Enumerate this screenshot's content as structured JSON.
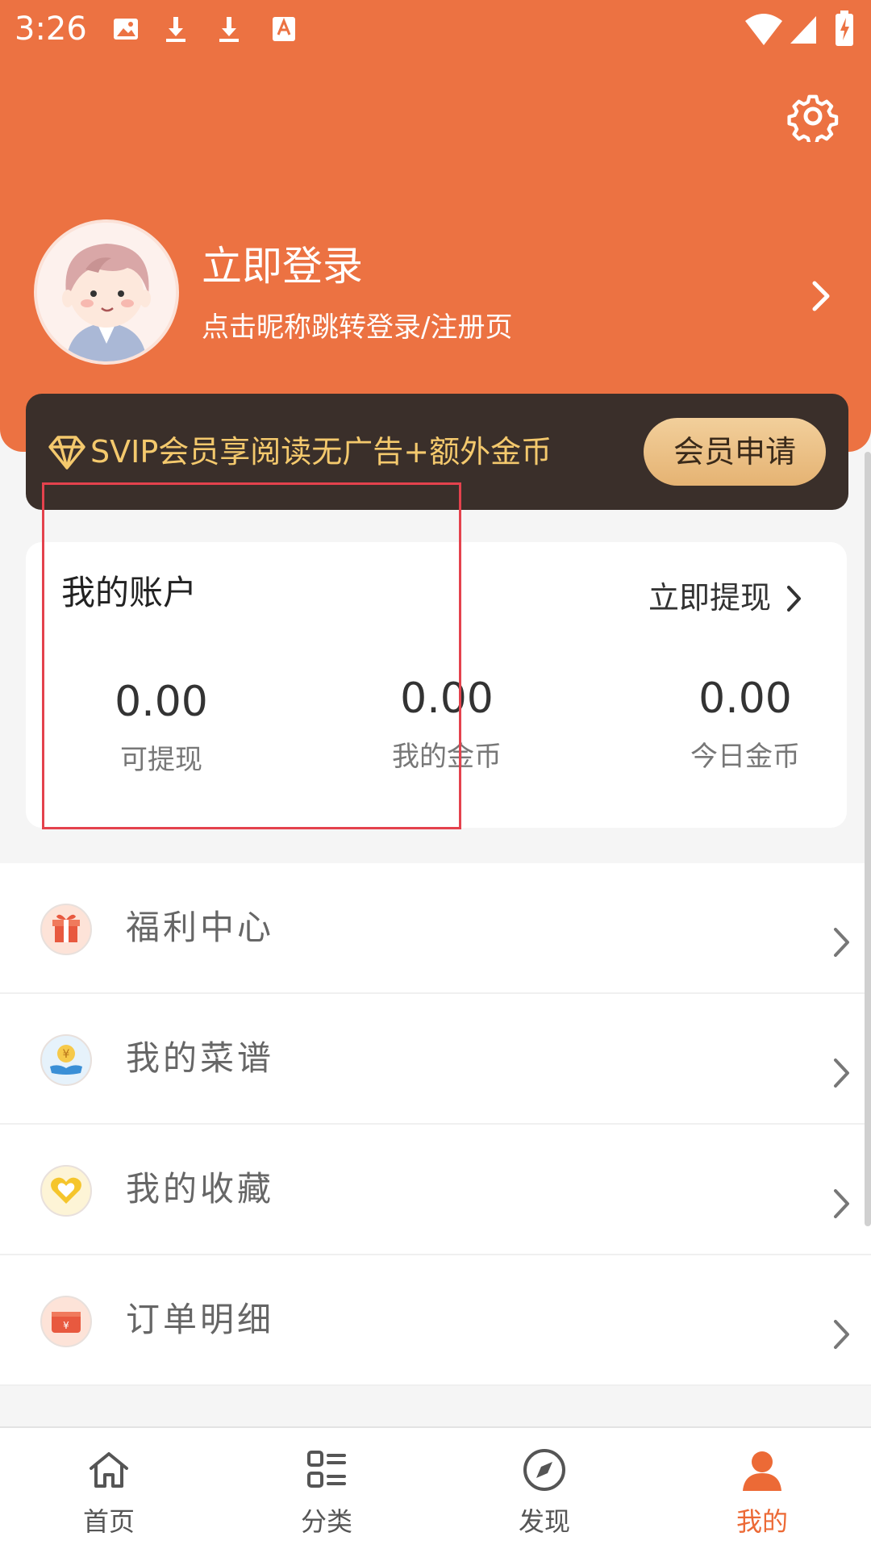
{
  "status_bar": {
    "time": "3:26",
    "icons": [
      "image-icon",
      "download-icon",
      "download-icon",
      "font-icon",
      "wifi-icon",
      "signal-icon",
      "battery-charging-icon"
    ]
  },
  "header": {
    "settings_icon": "gear-icon",
    "login_title": "立即登录",
    "login_subtitle": "点击昵称跳转登录/注册页"
  },
  "vip": {
    "text": "SVIP会员享阅读无广告+额外金币",
    "button": "会员申请"
  },
  "account": {
    "title": "我的账户",
    "withdraw_link": "立即提现",
    "stats": [
      {
        "value": "0.00",
        "label": "可提现"
      },
      {
        "value": "0.00",
        "label": "我的金币"
      },
      {
        "value": "0.00",
        "label": "今日金币"
      }
    ]
  },
  "menu": [
    {
      "label": "福利中心",
      "icon": "gift-icon"
    },
    {
      "label": "我的菜谱",
      "icon": "coin-hand-icon"
    },
    {
      "label": "我的收藏",
      "icon": "heart-icon"
    },
    {
      "label": "订单明细",
      "icon": "wallet-icon"
    }
  ],
  "tabs": [
    {
      "label": "首页",
      "icon": "home-icon"
    },
    {
      "label": "分类",
      "icon": "category-icon"
    },
    {
      "label": "发现",
      "icon": "compass-icon"
    },
    {
      "label": "我的",
      "icon": "user-icon",
      "active": true
    }
  ],
  "colors": {
    "brand": "#ec7242",
    "vip_gold": "#f4c96d",
    "active_tab": "#ec6a36",
    "highlight": "#e4424d"
  }
}
